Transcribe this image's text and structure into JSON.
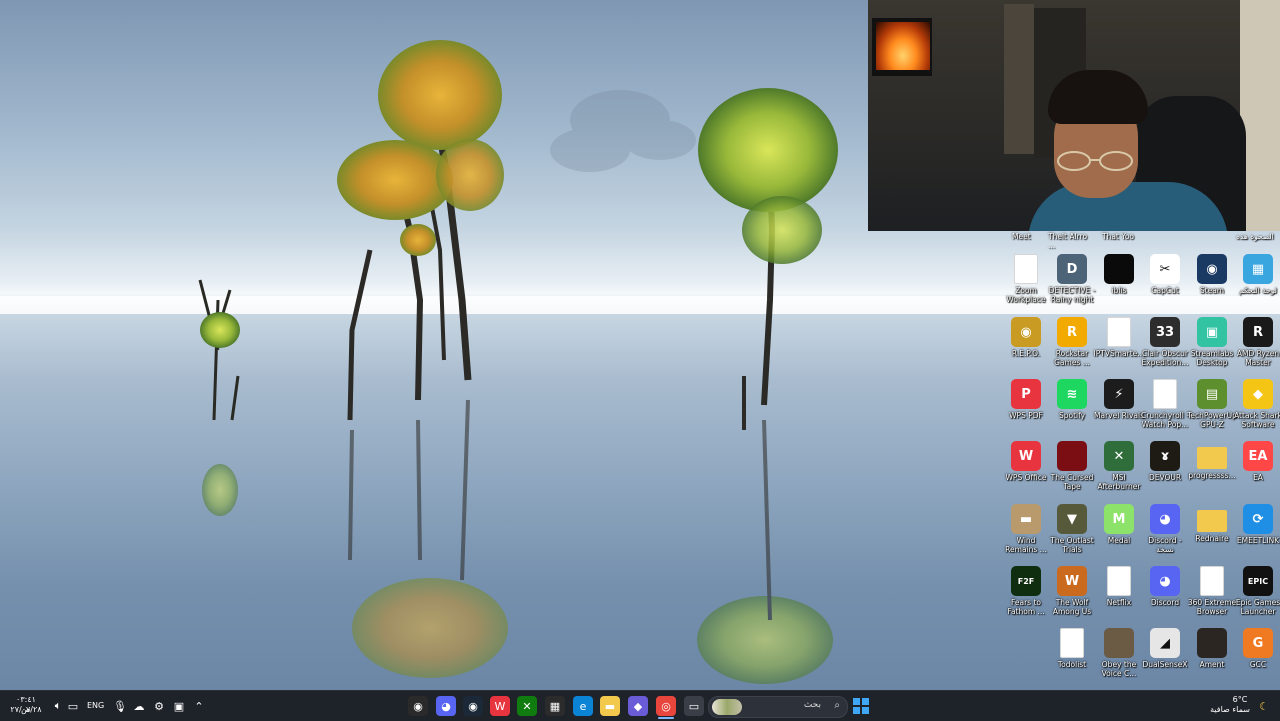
{
  "desktop": {
    "top_row_labels": [
      "Meet",
      "Thelt Alrro ...",
      "That Yoo",
      "",
      "",
      "الصحوة هذه"
    ],
    "icons": [
      {
        "label": "Zoom\nWorkplace",
        "icon": "doc-icon",
        "color": "#ffffff",
        "glyph": ""
      },
      {
        "label": "DETECTIVE -\nRainy night",
        "icon": "detective-game-icon",
        "color": "#4d6478",
        "glyph": "D"
      },
      {
        "label": "iblis",
        "icon": "iblis-game-icon",
        "color": "#0a0a0a",
        "glyph": ""
      },
      {
        "label": "CapCut",
        "icon": "capcut-icon",
        "color": "#ffffff",
        "glyph": "✂"
      },
      {
        "label": "Steam",
        "icon": "steam-icon",
        "color": "#1b3a63",
        "glyph": "◉"
      },
      {
        "label": "لوحة التحكم",
        "icon": "control-panel-icon",
        "color": "#3aa6e0",
        "glyph": "▦"
      },
      {
        "label": "R.E.P.O.",
        "icon": "repo-game-icon",
        "color": "#c99b22",
        "glyph": "◉"
      },
      {
        "label": "Rockstar\nGames ...",
        "icon": "rockstar-icon",
        "color": "#f2a900",
        "glyph": "R"
      },
      {
        "label": "IPTVSmarte...",
        "icon": "doc-icon",
        "color": "#ffffff",
        "glyph": ""
      },
      {
        "label": "Clair Obscur\nExpedition...",
        "icon": "clair-obscur-icon",
        "color": "#2d2d2d",
        "glyph": "33"
      },
      {
        "label": "Streamlabs\nDesktop",
        "icon": "streamlabs-icon",
        "color": "#31c3a2",
        "glyph": "▣"
      },
      {
        "label": "AMD Ryzen\nMaster",
        "icon": "ryzen-icon",
        "color": "#1a1a1a",
        "glyph": "R"
      },
      {
        "label": "WPS PDF",
        "icon": "wps-pdf-icon",
        "color": "#e8343f",
        "glyph": "P"
      },
      {
        "label": "Spotify",
        "icon": "spotify-icon",
        "color": "#1ed760",
        "glyph": "≋"
      },
      {
        "label": "Marvel Rivals",
        "icon": "marvel-rivals-icon",
        "color": "#1c1c1c",
        "glyph": "⚡"
      },
      {
        "label": "Crunchyroll -\nWatch Pop...",
        "icon": "doc-icon",
        "color": "#ffffff",
        "glyph": ""
      },
      {
        "label": "TechPowerUp\nGPU-Z",
        "icon": "gpuz-icon",
        "color": "#5e8f2e",
        "glyph": "▤"
      },
      {
        "label": "Attack Shark\nSoftware",
        "icon": "attack-shark-icon",
        "color": "#f5c516",
        "glyph": "◆"
      },
      {
        "label": "WPS Office",
        "icon": "wps-office-icon",
        "color": "#e8343f",
        "glyph": "W"
      },
      {
        "label": "The Cursed\nTape",
        "icon": "cursed-tape-icon",
        "color": "#7a0e12",
        "glyph": ""
      },
      {
        "label": "MSI\nAfterburner",
        "icon": "msi-afterburner-icon",
        "color": "#2f6d3a",
        "glyph": "✕"
      },
      {
        "label": "DEVOUR",
        "icon": "devour-icon",
        "color": "#1e1a14",
        "glyph": "ɤ"
      },
      {
        "label": "progressss...",
        "icon": "folder-icon",
        "color": "#f2c94c",
        "glyph": ""
      },
      {
        "label": "EA",
        "icon": "ea-icon",
        "color": "#ff4747",
        "glyph": "EA"
      },
      {
        "label": "Wind\nRemains ...",
        "icon": "wind-remains-icon",
        "color": "#b89a6c",
        "glyph": "▬"
      },
      {
        "label": "The Outlast\nTrials",
        "icon": "outlast-icon",
        "color": "#575a3a",
        "glyph": "▼"
      },
      {
        "label": "Medal",
        "icon": "medal-icon",
        "color": "#8de36a",
        "glyph": "M"
      },
      {
        "label": "Discord -\nنسخة",
        "icon": "discord-icon",
        "color": "#5865f2",
        "glyph": "◕"
      },
      {
        "label": "Rednaire",
        "icon": "folder-icon",
        "color": "#f2c94c",
        "glyph": ""
      },
      {
        "label": "EMEETLINK",
        "icon": "emeetlink-icon",
        "color": "#1f8fe6",
        "glyph": "⟳"
      },
      {
        "label": "Fears to\nFathom ...",
        "icon": "fears-to-fathom-icon",
        "color": "#0f2d0f",
        "glyph": "F2F"
      },
      {
        "label": "The Wolf\nAmong Us",
        "icon": "wolf-among-us-icon",
        "color": "#c96a1e",
        "glyph": "W"
      },
      {
        "label": "Netflix",
        "icon": "doc-icon",
        "color": "#ffffff",
        "glyph": ""
      },
      {
        "label": "Discord",
        "icon": "discord-icon",
        "color": "#5865f2",
        "glyph": "◕"
      },
      {
        "label": "360 Extreme\nBrowser",
        "icon": "doc-icon",
        "color": "#ffffff",
        "glyph": ""
      },
      {
        "label": "Epic Games\nLauncher",
        "icon": "epic-games-icon",
        "color": "#111111",
        "glyph": "EPIC"
      },
      {
        "label": "",
        "icon": "",
        "color": "",
        "glyph": ""
      },
      {
        "label": "Todolist",
        "icon": "doc-icon",
        "color": "#ffffff",
        "glyph": ""
      },
      {
        "label": "Obey the\nVoice C...",
        "icon": "obey-voice-icon",
        "color": "#6b5a44",
        "glyph": ""
      },
      {
        "label": "DualSenseX",
        "icon": "dualsensex-icon",
        "color": "#e6e6e6",
        "glyph": "◢"
      },
      {
        "label": "Ament",
        "icon": "ament-icon",
        "color": "#2b2622",
        "glyph": ""
      },
      {
        "label": "GCC",
        "icon": "gcc-icon",
        "color": "#f07a22",
        "glyph": "G"
      }
    ]
  },
  "taskbar": {
    "left": {
      "time": "٠٣:٤١ ص",
      "date": "٢٧/٠٧/٢٨",
      "language": "ENG"
    },
    "search_text": "بحث",
    "weather": {
      "temp": "6°C",
      "condition": "سماء صافية"
    },
    "pinned": [
      {
        "name": "obs-icon",
        "color": "#2a2a2a",
        "glyph": "◉"
      },
      {
        "name": "discord-taskbar-icon",
        "color": "#5865f2",
        "glyph": "◕"
      },
      {
        "name": "steam-taskbar-icon",
        "color": "#1b2838",
        "glyph": "◉"
      },
      {
        "name": "wps-taskbar-icon",
        "color": "#e8343f",
        "glyph": "W"
      },
      {
        "name": "xbox-icon",
        "color": "#107c10",
        "glyph": "✕"
      },
      {
        "name": "store-icon",
        "color": "#2b2b2b",
        "glyph": "▦"
      },
      {
        "name": "edge-icon",
        "color": "#0c84d6",
        "glyph": "e"
      },
      {
        "name": "file-explorer-icon",
        "color": "#f2c94c",
        "glyph": "▬"
      },
      {
        "name": "copilot-icon",
        "color": "#6a5bd6",
        "glyph": "◆"
      },
      {
        "name": "chrome-icon",
        "color": "#e8453c",
        "glyph": "◎"
      },
      {
        "name": "task-view-icon",
        "color": "#3a3f47",
        "glyph": "▭"
      }
    ]
  }
}
